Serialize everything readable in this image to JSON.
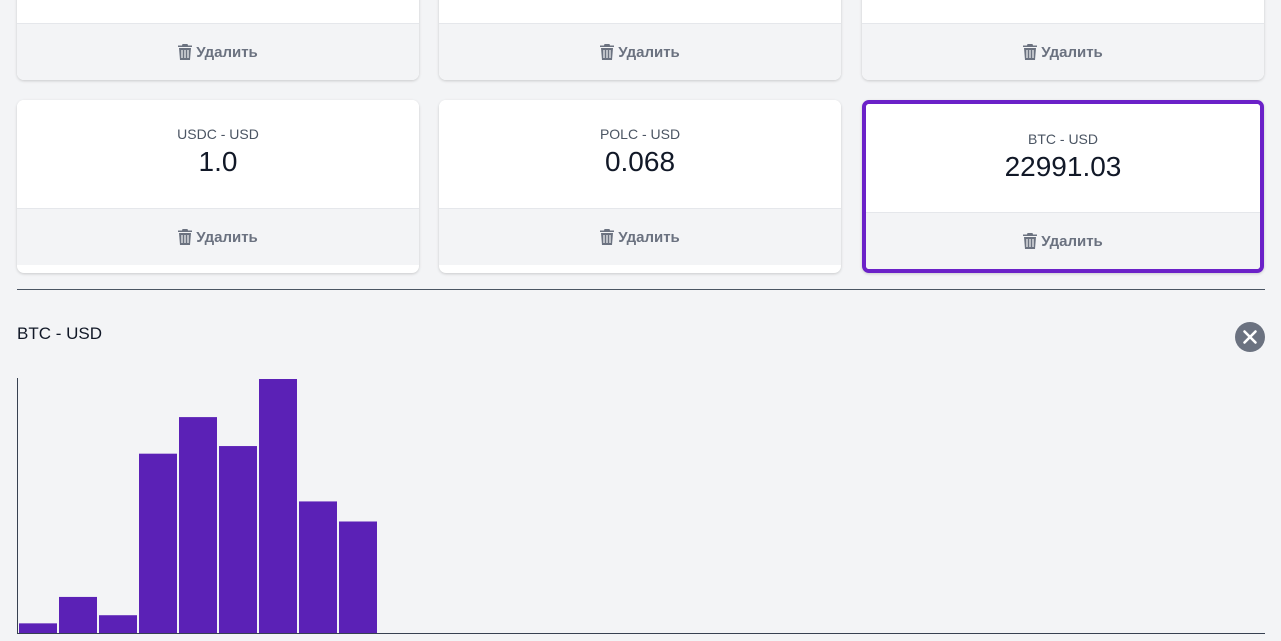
{
  "delete_label": "Удалить",
  "top_row": [
    {
      "delete_label": "Удалить"
    },
    {
      "delete_label": "Удалить"
    },
    {
      "delete_label": "Удалить"
    }
  ],
  "tickers": [
    {
      "name": "USDC - USD",
      "price": "1.0",
      "delete_label": "Удалить"
    },
    {
      "name": "POLC - USD",
      "price": "0.068",
      "delete_label": "Удалить"
    },
    {
      "name": "BTC - USD",
      "price": "22991.03",
      "delete_label": "Удалить",
      "selected": true
    }
  ],
  "graph": {
    "title": "BTC - USD"
  },
  "colors": {
    "bar": "#5b21b6",
    "selected_border": "#6b21c8",
    "close_button": "#6b7280",
    "background": "#f3f4f6"
  },
  "icons": {
    "delete": "trash-icon",
    "close": "close-icon"
  },
  "chart_data": {
    "type": "bar",
    "title": "",
    "xlabel": "",
    "ylabel": "",
    "values": [
      3.8,
      14.2,
      7.0,
      70.6,
      85.0,
      73.6,
      100.0,
      51.8,
      43.9
    ],
    "ylim": [
      0,
      100
    ],
    "grid": false
  }
}
